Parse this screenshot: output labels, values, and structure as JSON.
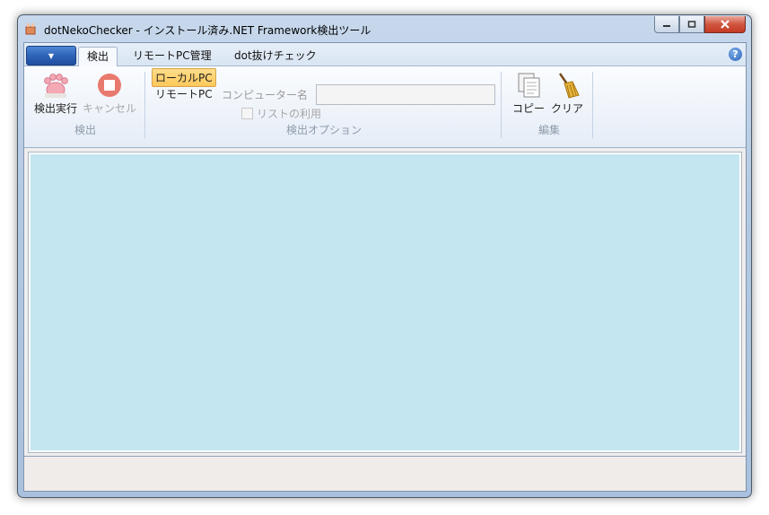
{
  "window": {
    "title": "dotNekoChecker - インストール済み.NET Framework検出ツール",
    "controls": [
      "minimize-icon",
      "restore-icon",
      "close-icon"
    ]
  },
  "ribbon": {
    "app_menu_icon": "chevron-down-icon",
    "tabs": [
      {
        "label": "検出",
        "active": true
      },
      {
        "label": "リモートPC管理",
        "active": false
      },
      {
        "label": "dot抜けチェック",
        "active": false
      }
    ],
    "help_icon": "help-icon",
    "groups": {
      "detect": {
        "label": "検出",
        "run_label": "検出実行",
        "run_icon": "paw-icon",
        "cancel_label": "キャンセル",
        "cancel_icon": "stop-icon"
      },
      "options": {
        "label": "検出オプション",
        "local_pc": "ローカルPC",
        "remote_pc": "リモートPC",
        "computer_name_label": "コンピューター名",
        "computer_name_value": "",
        "use_list_label": "リストの利用"
      },
      "edit": {
        "label": "編集",
        "copy_label": "コピー",
        "copy_icon": "copy-icon",
        "clear_label": "クリア",
        "clear_icon": "broom-icon"
      }
    }
  },
  "colors": {
    "output_bg": "#c3e6f0",
    "selected_option": "#ffc85a",
    "close_button": "#c43a24"
  }
}
